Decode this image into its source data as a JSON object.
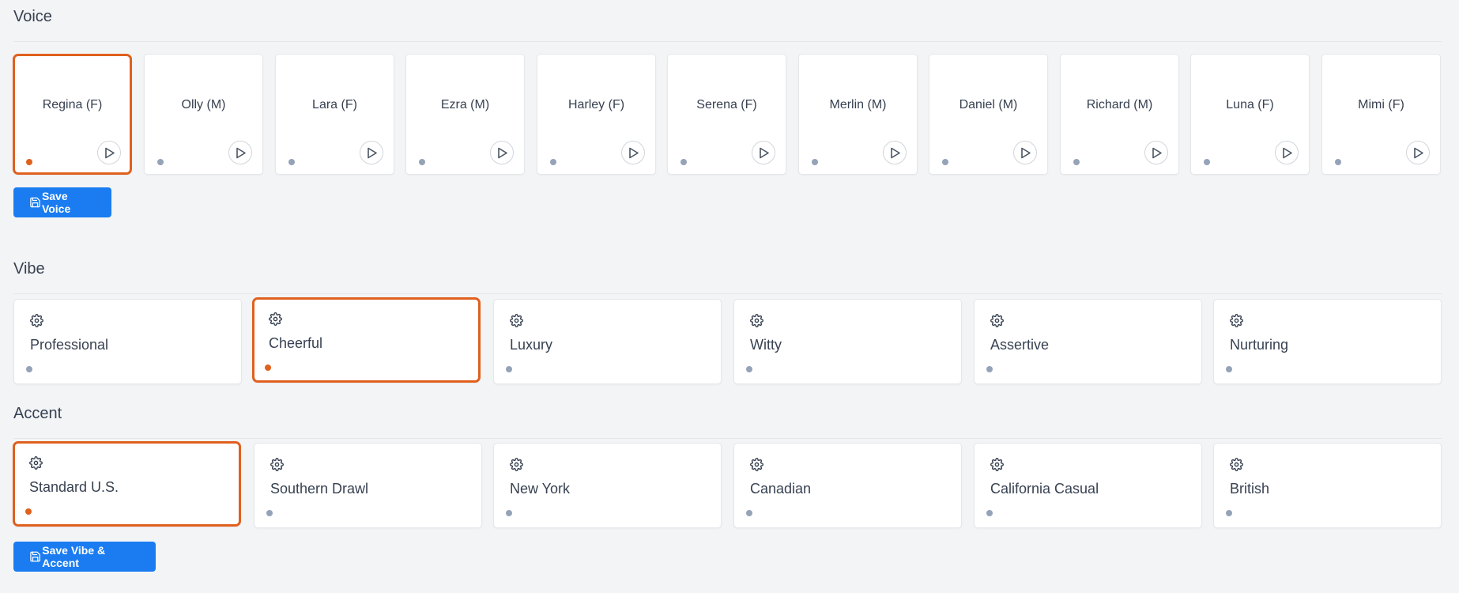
{
  "voice_section": {
    "title": "Voice",
    "cards": [
      {
        "label": "Regina (F)",
        "selected": true
      },
      {
        "label": "Olly (M)",
        "selected": false
      },
      {
        "label": "Lara (F)",
        "selected": false
      },
      {
        "label": "Ezra (M)",
        "selected": false
      },
      {
        "label": "Harley (F)",
        "selected": false
      },
      {
        "label": "Serena (F)",
        "selected": false
      },
      {
        "label": "Merlin (M)",
        "selected": false
      },
      {
        "label": "Daniel (M)",
        "selected": false
      },
      {
        "label": "Richard (M)",
        "selected": false
      },
      {
        "label": "Luna (F)",
        "selected": false
      },
      {
        "label": "Mimi (F)",
        "selected": false
      }
    ],
    "save_label": "Save Voice"
  },
  "vibe_section": {
    "title": "Vibe",
    "cards": [
      {
        "label": "Professional",
        "selected": false
      },
      {
        "label": "Cheerful",
        "selected": true
      },
      {
        "label": "Luxury",
        "selected": false
      },
      {
        "label": "Witty",
        "selected": false
      },
      {
        "label": "Assertive",
        "selected": false
      },
      {
        "label": "Nurturing",
        "selected": false
      }
    ]
  },
  "accent_section": {
    "title": "Accent",
    "cards": [
      {
        "label": "Standard U.S.",
        "selected": true
      },
      {
        "label": "Southern Drawl",
        "selected": false
      },
      {
        "label": "New York",
        "selected": false
      },
      {
        "label": "Canadian",
        "selected": false
      },
      {
        "label": "California Casual",
        "selected": false
      },
      {
        "label": "British",
        "selected": false
      }
    ],
    "save_label": "Save Vibe & Accent"
  },
  "icons": {
    "play": "play-icon",
    "gear": "gear-icon",
    "save": "floppy-disk-icon",
    "status": "status-dot"
  },
  "colors": {
    "accent_selected": "#e0601e",
    "button_primary": "#1a7cf0",
    "dot_inactive": "#94a3b8",
    "background": "#f3f4f6"
  }
}
